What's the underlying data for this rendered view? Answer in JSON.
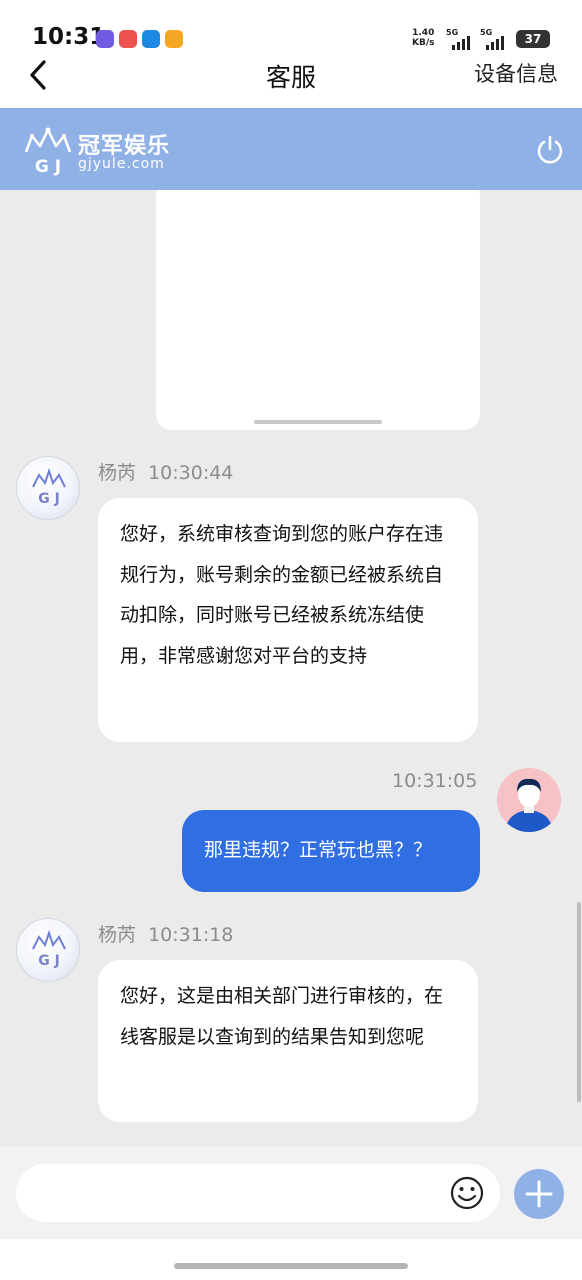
{
  "status_bar": {
    "time": "10:31",
    "net_speed": "1.40",
    "net_unit": "KB/s",
    "signal_1": "5G",
    "signal_2": "5G",
    "battery": "37",
    "app_icon_colors": [
      "#6f5ce0",
      "#ef5350",
      "#1e88e5",
      "#f5a623"
    ]
  },
  "title_bar": {
    "back_icon": "chevron-left-icon",
    "title": "客服",
    "right_action": "设备信息"
  },
  "brand": {
    "name": "冠军娱乐",
    "domain": "gjyule.com",
    "logo_letters": "G J",
    "accent_color": "#8fb1e6",
    "power_icon": "power-icon"
  },
  "messages": [
    {
      "sender": "杨芮",
      "time": "10:30:44",
      "text": "您好，系统审核查询到您的账户存在违规行为，账号剩余的金额已经被系统自动扣除，同时账号已经被系统冻结使用，非常感谢您对平台的支持"
    },
    {
      "time": "10:31:05",
      "text": "那里违规？正常玩也黑？？"
    },
    {
      "sender": "杨芮",
      "time": "10:31:18",
      "text": "您好，这是由相关部门进行审核的，在线客服是以查询到的结果告知到您呢"
    }
  ],
  "input": {
    "placeholder": "",
    "emoji_icon": "emoji-icon",
    "plus_icon": "plus-icon"
  },
  "colors": {
    "outgoing_bubble": "#2f6fe1",
    "chat_background": "#ebebeb"
  }
}
